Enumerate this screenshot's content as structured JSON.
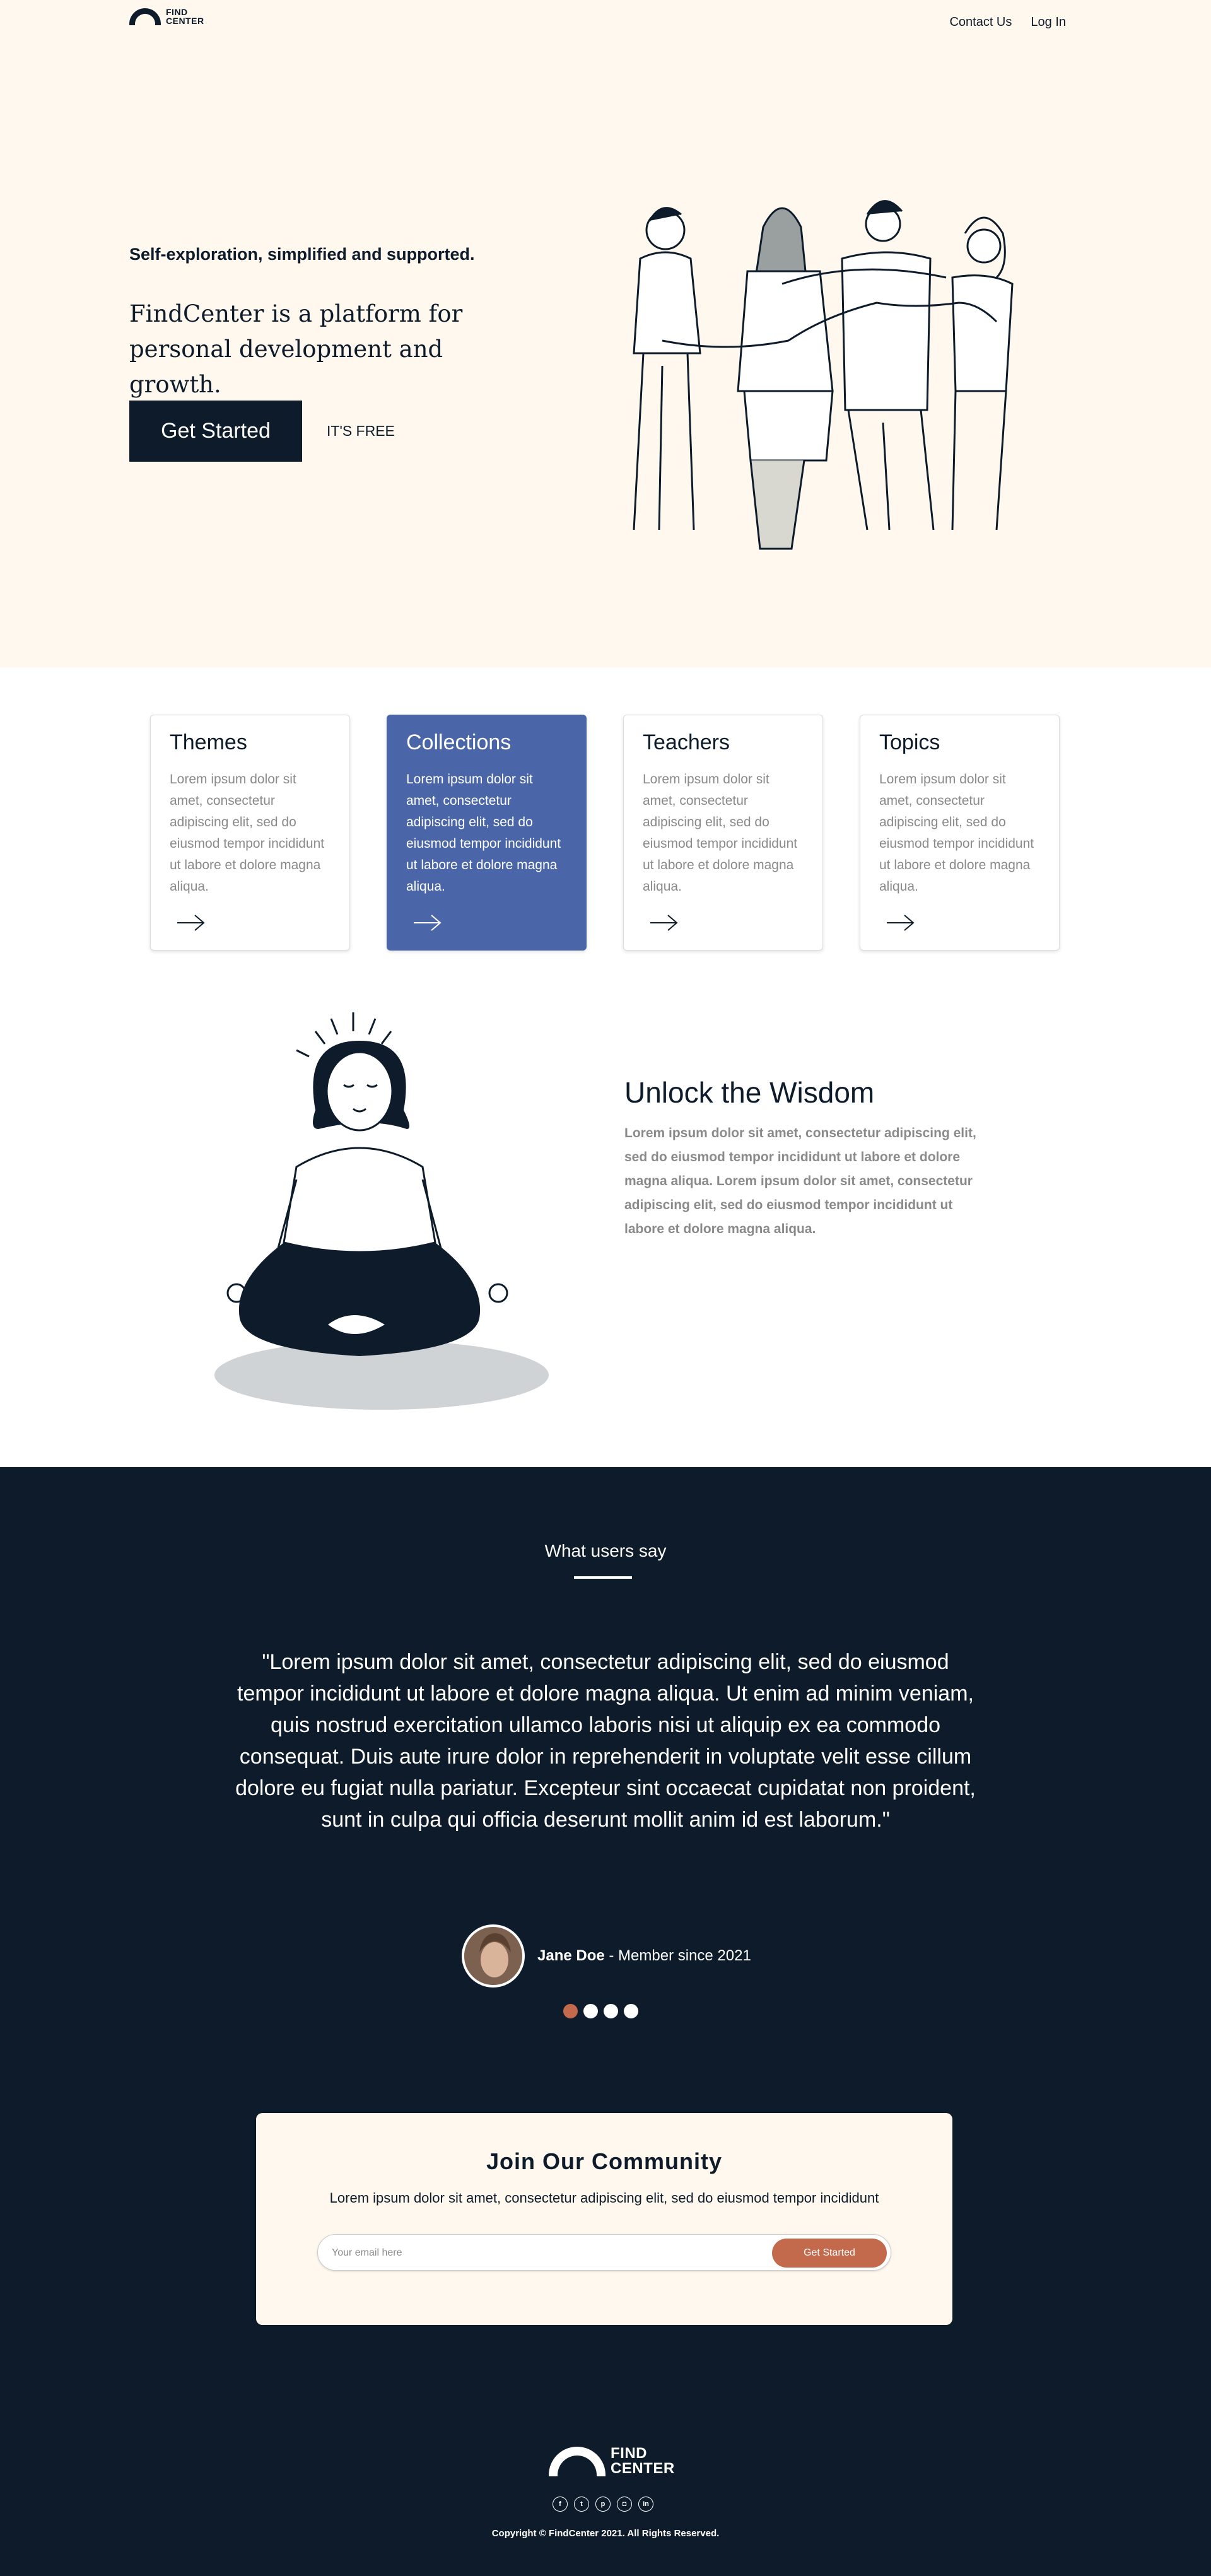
{
  "header": {
    "logo_line1": "FIND",
    "logo_line2": "CENTER",
    "nav": [
      "Contact Us",
      "Log In"
    ]
  },
  "hero": {
    "tagline": "Self-exploration, simplified and supported.",
    "headline": "FindCenter is a platform for personal development and growth.",
    "cta_label": "Get Started",
    "free_label": "IT'S FREE"
  },
  "cards": [
    {
      "title": "Themes",
      "text": "Lorem ipsum dolor sit amet, consectetur adipiscing elit, sed do eiusmod tempor incididunt ut labore et dolore magna aliqua.",
      "active": false
    },
    {
      "title": "Collections",
      "text": "Lorem ipsum dolor sit amet, consectetur adipiscing elit, sed do eiusmod tempor incididunt ut labore et dolore magna aliqua.",
      "active": true
    },
    {
      "title": "Teachers",
      "text": "Lorem ipsum dolor sit amet, consectetur adipiscing elit, sed do eiusmod tempor incididunt ut labore et dolore magna aliqua.",
      "active": false
    },
    {
      "title": "Topics",
      "text": "Lorem ipsum dolor sit amet, consectetur adipiscing elit, sed do eiusmod tempor incididunt ut labore et dolore magna aliqua.",
      "active": false
    }
  ],
  "wisdom": {
    "title": "Unlock the Wisdom",
    "text": "Lorem ipsum dolor sit amet, consectetur adipiscing elit, sed do eiusmod tempor incididunt ut labore et dolore magna aliqua. Lorem ipsum dolor sit amet, consectetur adipiscing elit, sed do eiusmod tempor incididunt ut labore et dolore magna aliqua."
  },
  "testimonials": {
    "title": "What users say",
    "quote": "\"Lorem ipsum dolor sit amet, consectetur adipiscing elit, sed do eiusmod tempor incididunt ut labore et dolore magna aliqua. Ut enim ad minim veniam, quis nostrud exercitation ullamco laboris nisi ut aliquip ex ea commodo consequat. Duis aute irure dolor in reprehenderit in voluptate velit esse cillum dolore eu fugiat nulla pariatur. Excepteur sint occaecat cupidatat non proident, sunt in culpa qui officia deserunt mollit anim id est laborum.\"",
    "name": "Jane Doe",
    "member_since": " - Member since 2021",
    "slide_count": 4,
    "active_slide": 1
  },
  "community": {
    "title": "Join Our Community",
    "text": "Lorem ipsum dolor sit amet, consectetur adipiscing elit, sed do eiusmod tempor incididunt",
    "email_placeholder": "Your email here",
    "button_label": "Get Started"
  },
  "footer": {
    "logo_line1": "FIND",
    "logo_line2": "CENTER",
    "socials": [
      "facebook-icon",
      "twitter-icon",
      "pinterest-icon",
      "instagram-icon",
      "linkedin-icon"
    ],
    "copyright": "Copyright © FindCenter 2021. All Rights Reserved."
  },
  "colors": {
    "navy": "#0d1b2a",
    "cream": "#fff8ee",
    "blue": "#4a66a8",
    "terracotta": "#c46a4c"
  }
}
